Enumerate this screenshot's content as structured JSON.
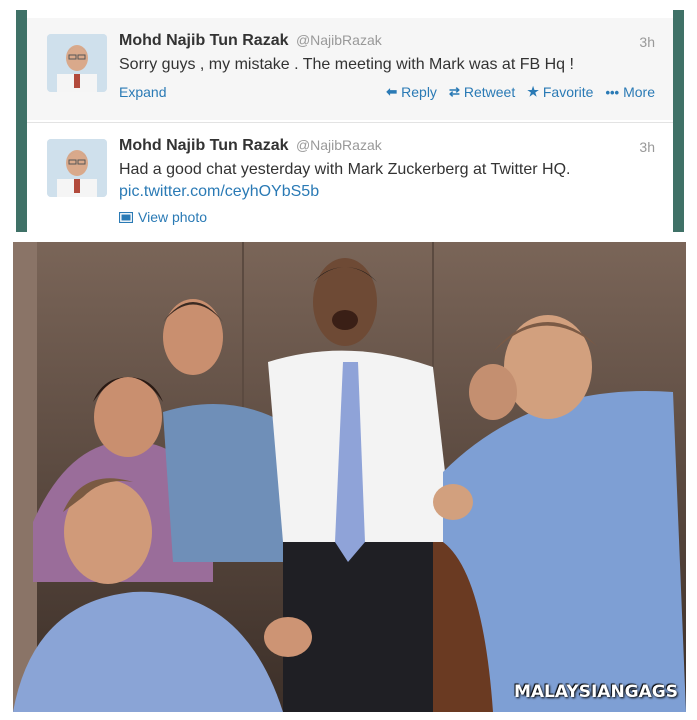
{
  "tweets": [
    {
      "name": "Mohd Najib Tun Razak",
      "handle": "@NajibRazak",
      "time": "3h",
      "text": "Sorry guys , my mistake . The meeting with Mark was at FB Hq !",
      "expand_label": "Expand",
      "actions": {
        "reply": "Reply",
        "retweet": "Retweet",
        "favorite": "Favorite",
        "more": "More"
      }
    },
    {
      "name": "Mohd Najib Tun Razak",
      "handle": "@NajibRazak",
      "time": "3h",
      "text": "Had a good chat yesterday with Mark Zuckerberg at Twitter HQ.",
      "link": "pic.twitter.com/ceyhOYbS5b",
      "view_photo_label": "View photo"
    }
  ],
  "photo": {
    "watermark": "MALAYSIANGAGS"
  },
  "colors": {
    "frame": "#3f7167",
    "link": "#2a7ab5",
    "text": "#333333",
    "muted": "#999999"
  },
  "icons": [
    "reply-icon",
    "retweet-icon",
    "favorite-star-icon",
    "more-dots-icon",
    "photo-icon"
  ]
}
